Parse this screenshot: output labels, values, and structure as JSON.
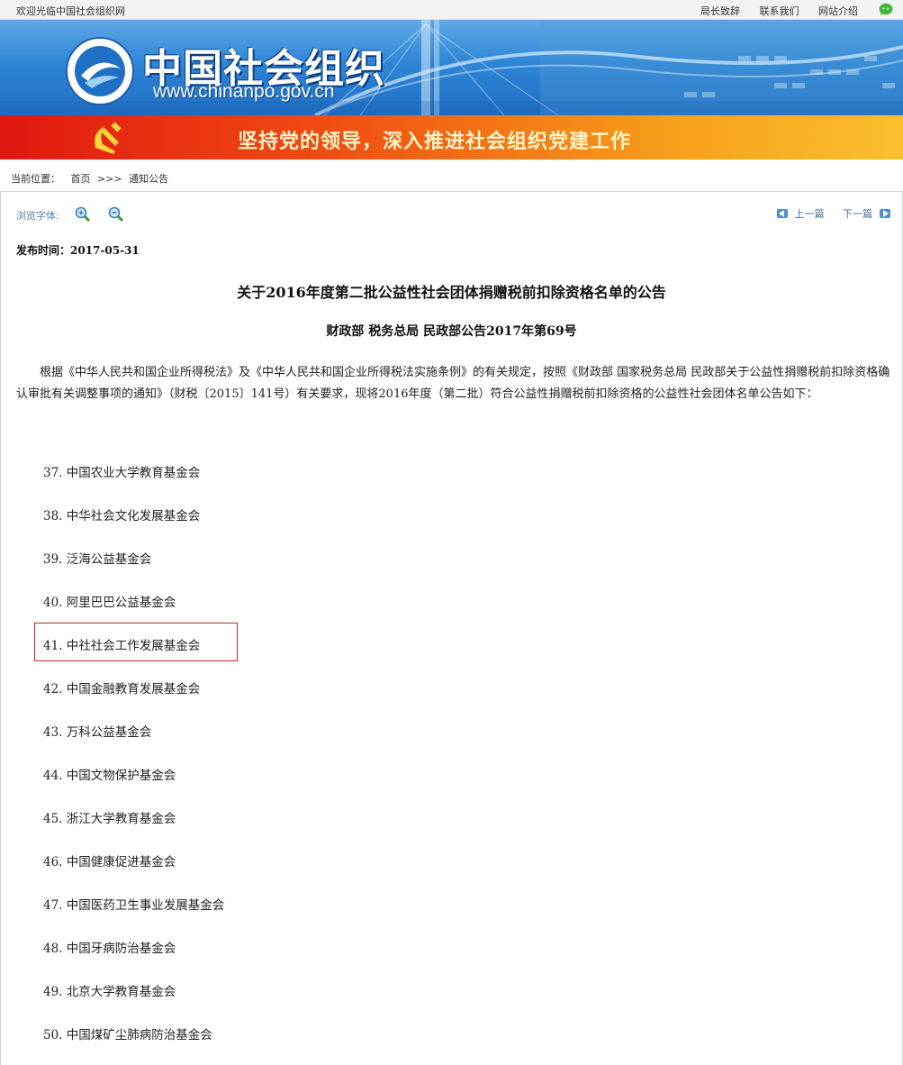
{
  "topbar": {
    "welcome": "欢迎光临中国社会组织网",
    "links": [
      "局长致辞",
      "联系我们",
      "网站介绍"
    ]
  },
  "banner": {
    "site_name": "中国社会组织",
    "site_url": "www.chinanpo.gov.cn",
    "slogan": "坚持党的领导，深入推进社会组织党建工作"
  },
  "breadcrumb": {
    "label": "当前位置：",
    "home": "首页",
    "separator": ">>>",
    "current": "通知公告"
  },
  "tools": {
    "font_label": "浏览字体:",
    "prev": "上一篇",
    "next": "下一篇"
  },
  "article": {
    "pubtime": "发布时间：2017-05-31",
    "title": "关于2016年度第二批公益性社会团体捐赠税前扣除资格名单的公告",
    "subtitle": "财政部 税务总局 民政部公告2017年第69号",
    "intro": "根据《中华人民共和国企业所得税法》及《中华人民共和国企业所得税法实施条例》的有关规定，按照《财政部 国家税务总局 民政部关于公益性捐赠税前扣除资格确认审批有关调整事项的通知》（财税〔2015〕141号）有关要求，现将2016年度（第二批）符合公益性捐赠税前扣除资格的公益性社会团体名单公告如下：",
    "items": [
      "37. 中国农业大学教育基金会",
      "38. 中华社会文化发展基金会",
      "39. 泛海公益基金会",
      "40. 阿里巴巴公益基金会",
      "41. 中社社会工作发展基金会",
      "42. 中国金融教育发展基金会",
      "43. 万科公益基金会",
      "44. 中国文物保护基金会",
      "45. 浙江大学教育基金会",
      "46. 中国健康促进基金会",
      "47. 中国医药卫生事业发展基金会",
      "48. 中国牙病防治基金会",
      "49. 北京大学教育基金会",
      "50. 中国煤矿尘肺病防治基金会"
    ]
  },
  "colors": {
    "highlight_border": "#c8262c",
    "banner_blue": "#2f86d6",
    "party_red": "#e0170f"
  }
}
